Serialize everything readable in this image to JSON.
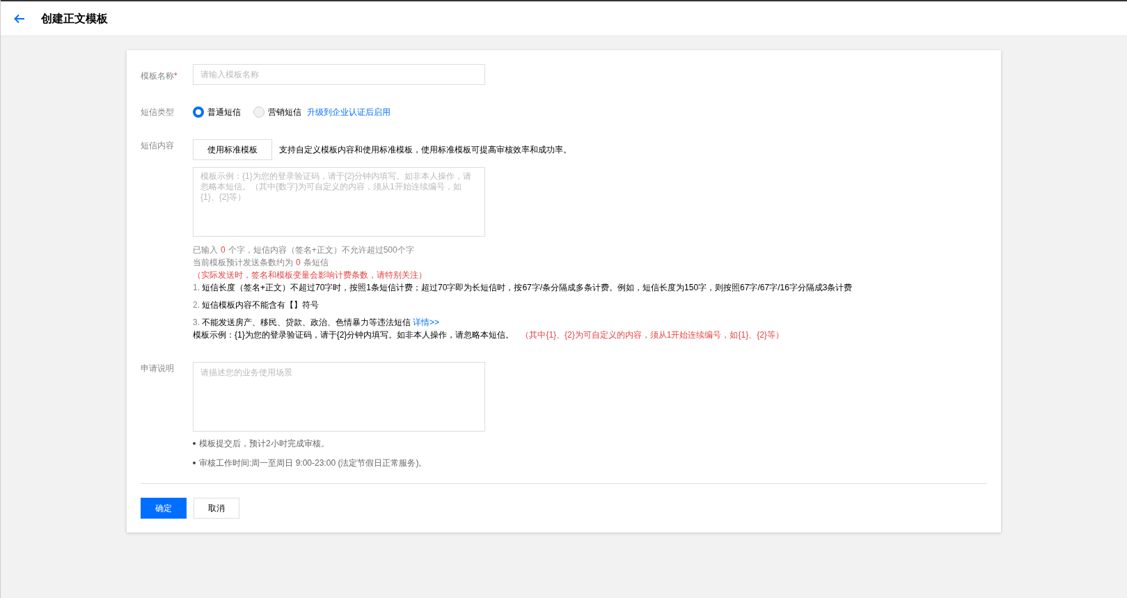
{
  "header": {
    "title": "创建正文模板"
  },
  "name_field": {
    "label": "模板名称",
    "required_mark": "*",
    "placeholder": "请输入模板名称"
  },
  "sms_type": {
    "label": "短信类型",
    "options": [
      {
        "label": "普通短信",
        "selected": true
      },
      {
        "label": "营销短信",
        "selected": false
      }
    ],
    "upgrade_link": "升级到企业认证后启用"
  },
  "content": {
    "label": "短信内容",
    "standard_button": "使用标准模板",
    "hint": "支持自定义模板内容和使用标准模板，使用标准模板可提高审核效率和成功率。",
    "placeholder": "模板示例：{1}为您的登录验证码，请于{2}分钟内填写。如非本人操作，请忽略本短信。（其中{数字}为可自定义的内容，须从1开始连续编号，如{1}、{2}等）",
    "count_line": {
      "prefix": "已输入",
      "count": "0",
      "suffix": "个字，短信内容（签名+正文）不允许超过500个字"
    },
    "estimate_line": {
      "prefix": "当前模板预计发送条数约为",
      "count": "0",
      "suffix": "条短信"
    },
    "warning": "（实际发送时，签名和模板变量会影响计费条数，请特别关注）",
    "rules": [
      {
        "number": "1.",
        "text": "短信长度（签名+正文）不超过70字时，按照1条短信计费；超过70字即为长短信时，按67字/条分隔成多条计费。例如，短信长度为150字，则按照67字/67字/16字分隔成3条计费"
      },
      {
        "number": "2.",
        "text": "短信模板内容不能含有【】符号"
      },
      {
        "number": "3.",
        "text": "不能发送房产、移民、贷款、政治、色情暴力等违法短信",
        "link": "详情>>"
      }
    ],
    "example": "模板示例：{1}为您的登录验证码，请于{2}分钟内填写。如非本人操作，请忽略本短信。",
    "example_note": "（其中{1}、{2}为可自定义的内容，须从1开始连续编号，如{1}、{2}等）"
  },
  "application": {
    "label": "申请说明",
    "placeholder": "请描述您的业务使用场景",
    "notes": [
      "模板提交后，预计2小时完成审核。",
      "审核工作时间:周一至周日 9:00-23:00 (法定节假日正常服务)。"
    ]
  },
  "buttons": [
    {
      "label": "确定",
      "kind": "primary"
    },
    {
      "label": "取消",
      "kind": "secondary"
    }
  ]
}
